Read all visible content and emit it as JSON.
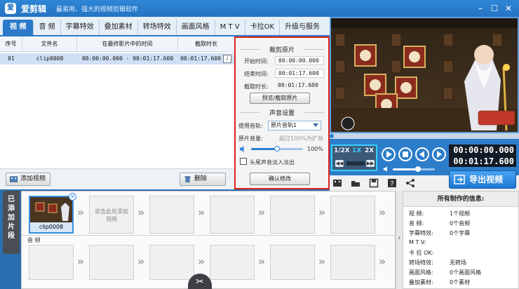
{
  "app": {
    "logo_char": "爱",
    "name": "爱剪辑",
    "slogan": "最易用、强大的视频剪辑软件"
  },
  "window_controls": {
    "minimize": "–",
    "maximize": "☐",
    "close": "✕"
  },
  "tabs": [
    {
      "label": "视 频",
      "active": true
    },
    {
      "label": "音 频"
    },
    {
      "label": "字幕特效"
    },
    {
      "label": "叠加素材"
    },
    {
      "label": "转场特效"
    },
    {
      "label": "画面风格"
    },
    {
      "label": "M T V"
    },
    {
      "label": "卡拉OK"
    },
    {
      "label": "升级与服务"
    }
  ],
  "clip_table": {
    "headers": [
      "序号",
      "文件名",
      "在最终影片中的时间",
      "截取时长"
    ],
    "rows": [
      {
        "index": "01",
        "filename": "clip0008",
        "range": "00:00:00.000 - 00:01:17.600",
        "duration": "00:01:17.600"
      }
    ]
  },
  "left_buttons": {
    "add_video": "添加视频",
    "delete": "删除"
  },
  "cut_panel": {
    "section1_title": "裁剪原片",
    "start_label": "开始时间:",
    "start_value": "00:00:00.000",
    "end_label": "结束时间:",
    "end_value": "00:01:17.600",
    "duration_label": "截取时长:",
    "duration_value": "00:01:17.600",
    "preview_button": "预览/截取原片",
    "section2_title": "声音设置",
    "track_label": "使用音轨:",
    "track_value": "原片音轨1",
    "volume_label": "原片音量:",
    "volume_hint": "超过100%为扩音",
    "volume_value": "100%",
    "volume_level": 0.5,
    "fade_label": "头尾声音淡入淡出",
    "fade_checked": false,
    "confirm_button": "确认修改"
  },
  "player": {
    "speeds": [
      "1/2X",
      "1X",
      "2X"
    ],
    "current_time": "00:00:00.000",
    "total_time": "00:01:17.600",
    "volume_level": 0.6,
    "progress": 0.0
  },
  "export_button": "导出视频",
  "timeline": {
    "side_label": "已添加片段",
    "clips": [
      {
        "name": "clip0008"
      }
    ],
    "add_placeholder": "双击此处添加视频",
    "audio_label": "音 频"
  },
  "info_panel": {
    "title": "所有制作的信息:",
    "rows": [
      {
        "key": "视    频:",
        "value": "1个视频"
      },
      {
        "key": "音    频:",
        "value": "0个音频"
      },
      {
        "key": "字幕特效:",
        "value": "0个字幕"
      },
      {
        "key": "M  T  V:",
        "value": ""
      },
      {
        "key": "卡 拉 OK:",
        "value": ""
      },
      {
        "key": "转场特效:",
        "value": "无转场"
      },
      {
        "key": "画面风格:",
        "value": "0个画面风格"
      },
      {
        "key": "叠加素材:",
        "value": "0个素材"
      }
    ]
  },
  "colors": {
    "accent": "#2a7ac9",
    "highlight": "#e0221f",
    "speed_border": "#36d0ff"
  }
}
